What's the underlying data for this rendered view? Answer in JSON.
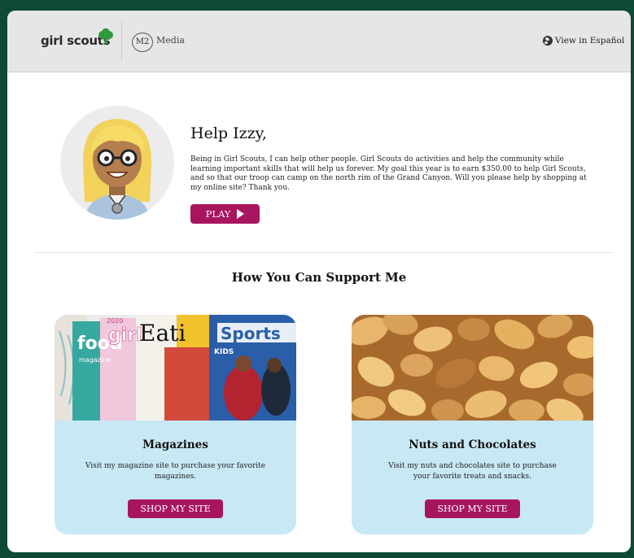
{
  "header": {
    "logo_text": "girl scouts",
    "m2_badge": "M2",
    "media_label": "Media",
    "language_link": "View in Español"
  },
  "profile": {
    "greeting": "Help Izzy,",
    "message": "Being in Girl Scouts, I can help other people. Girl Scouts do activities and help the community while learning important skills that will help us forever. My goal this year is to earn $350.00 to help Girl Scouts, and so that our troop can camp on the north rim of the Grand Canyon. Will you please help by shopping at my online site? Thank you.",
    "play_label": "PLAY"
  },
  "support": {
    "heading": "How You Can Support Me",
    "products": [
      {
        "title": "Magazines",
        "description": "Visit my magazine site to purchase your favorite magazines.",
        "button_label": "SHOP MY SITE",
        "cover_texts": [
          "food",
          "magazine",
          "girl",
          "2020",
          "Eati",
          "Sports",
          "KIDS"
        ]
      },
      {
        "title": "Nuts and Chocolates",
        "description": "Visit my nuts and chocolates site to purchase your favorite treats and snacks.",
        "button_label": "SHOP MY SITE"
      }
    ]
  },
  "colors": {
    "accent": "#a8155f",
    "card_bg": "#c8e8f4",
    "frame": "#0d4a35",
    "clover": "#2e9a3c"
  }
}
